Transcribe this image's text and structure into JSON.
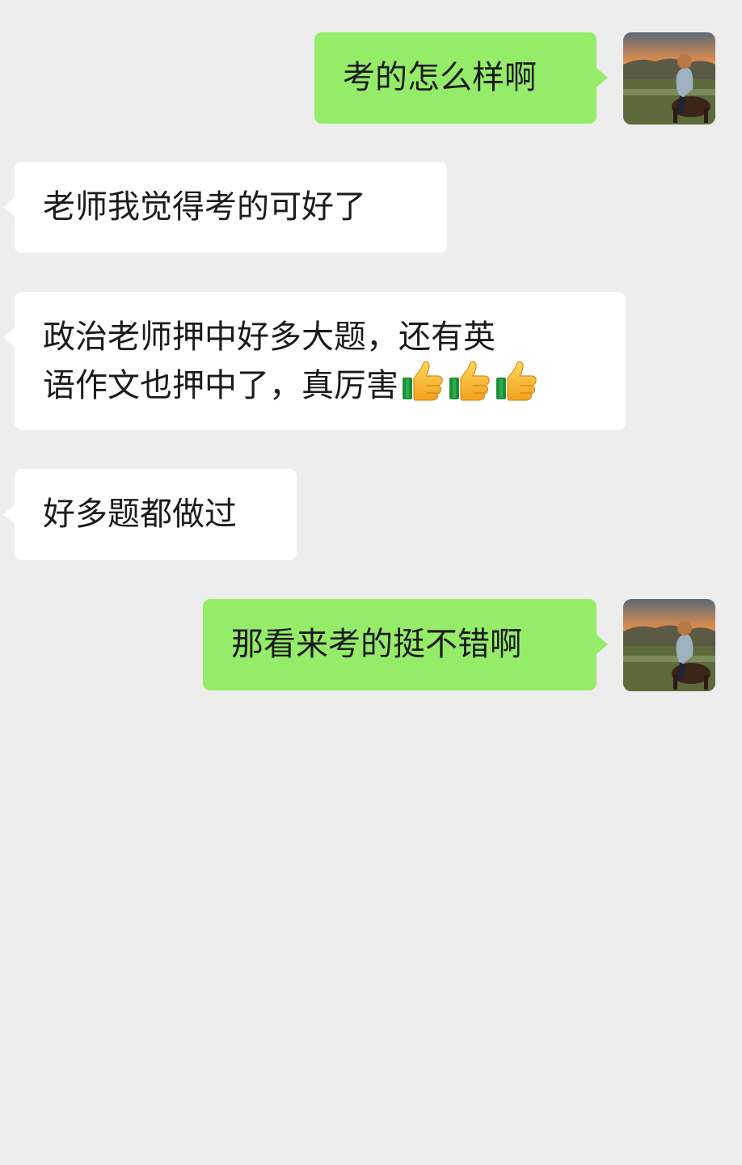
{
  "colors": {
    "background": "#ededed",
    "outgoing_bubble": "#95ec69",
    "incoming_bubble": "#ffffff",
    "text": "#1b1b1b"
  },
  "messages": [
    {
      "direction": "outgoing",
      "text": "考的怎么样啊"
    },
    {
      "direction": "incoming",
      "text": "老师我觉得考的可好了"
    },
    {
      "direction": "incoming",
      "lines": [
        "政治老师押中好多大题，还有英",
        "语作文也押中了，真厉害"
      ],
      "emoji": [
        "thumbs-up-icon",
        "thumbs-up-icon",
        "thumbs-up-icon"
      ]
    },
    {
      "direction": "incoming",
      "text": "好多题都做过"
    },
    {
      "direction": "outgoing",
      "text": "那看来考的挺不错啊"
    }
  ],
  "self_avatar": {
    "icon": "avatar-photo-person-on-horse"
  }
}
